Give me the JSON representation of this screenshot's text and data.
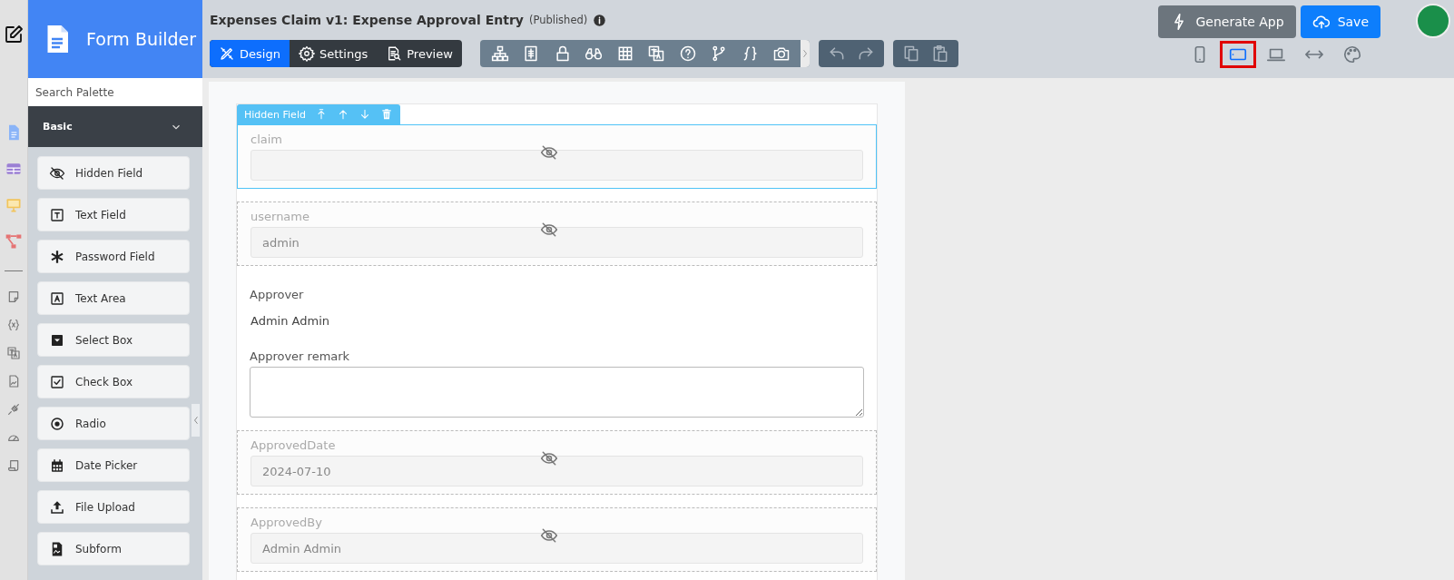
{
  "rail": [
    {
      "kind": "edit"
    },
    {
      "kind": "form"
    },
    {
      "kind": "datalist"
    },
    {
      "kind": "userview"
    },
    {
      "kind": "process"
    },
    {
      "kind": "separator"
    },
    {
      "kind": "note"
    },
    {
      "kind": "variable"
    },
    {
      "kind": "translate"
    },
    {
      "kind": "report"
    },
    {
      "kind": "plugin"
    },
    {
      "kind": "gauge"
    },
    {
      "kind": "script"
    }
  ],
  "palette": {
    "title": "Form Builder",
    "search": {
      "placeholder": "Search Palette"
    },
    "category": {
      "label": "Basic",
      "expanded": true
    },
    "items": [
      {
        "label": "Hidden Field",
        "kind": "hidden"
      },
      {
        "label": "Text Field",
        "kind": "textfield"
      },
      {
        "label": "Password Field",
        "kind": "password"
      },
      {
        "label": "Text Area",
        "kind": "textarea"
      },
      {
        "label": "Select Box",
        "kind": "select"
      },
      {
        "label": "Check Box",
        "kind": "checkbox"
      },
      {
        "label": "Radio",
        "kind": "radio"
      },
      {
        "label": "Date Picker",
        "kind": "date"
      },
      {
        "label": "File Upload",
        "kind": "upload"
      },
      {
        "label": "Subform",
        "kind": "subform"
      }
    ]
  },
  "header": {
    "title": "Expenses Claim v1: Expense Approval Entry",
    "status": "(Published)",
    "mode_tabs": [
      {
        "label": "Design",
        "kind": "design",
        "selected": true
      },
      {
        "label": "Settings",
        "kind": "settings",
        "selected": false
      },
      {
        "label": "Preview",
        "kind": "preview",
        "selected": false
      }
    ],
    "tools": [
      {
        "kind": "tree"
      },
      {
        "kind": "properties"
      },
      {
        "kind": "lock"
      },
      {
        "kind": "binoculars"
      },
      {
        "kind": "grid"
      },
      {
        "kind": "translate"
      },
      {
        "kind": "help"
      },
      {
        "kind": "branch"
      },
      {
        "kind": "braces"
      },
      {
        "kind": "camera"
      }
    ],
    "history": [
      {
        "kind": "undo"
      },
      {
        "kind": "redo"
      }
    ],
    "clipboard": [
      {
        "kind": "copy"
      },
      {
        "kind": "paste"
      }
    ],
    "buttons": [
      {
        "label": "Generate App",
        "kind": "generate"
      },
      {
        "label": "Save",
        "kind": "save"
      }
    ],
    "device_views": [
      {
        "kind": "phone",
        "selected": false
      },
      {
        "kind": "tablet",
        "selected": true
      },
      {
        "kind": "laptop",
        "selected": false
      },
      {
        "kind": "full",
        "selected": false
      },
      {
        "kind": "palette",
        "selected": false
      }
    ]
  },
  "form": {
    "toolbar_label": "Hidden Field",
    "fields": [
      {
        "kind": "hidden",
        "label": "claim",
        "selected": true
      },
      {
        "kind": "hidden",
        "label": "username",
        "value": "admin",
        "selected": false
      },
      {
        "kind": "display",
        "label": "Approver",
        "value": "Admin Admin",
        "selected": false
      },
      {
        "kind": "textarea",
        "label": "Approver remark",
        "selected": false
      },
      {
        "kind": "hidden",
        "label": "ApprovedDate",
        "value": "2024-07-10",
        "selected": false
      },
      {
        "kind": "hidden",
        "label": "ApprovedBy",
        "value": "Admin Admin",
        "selected": false
      }
    ]
  }
}
